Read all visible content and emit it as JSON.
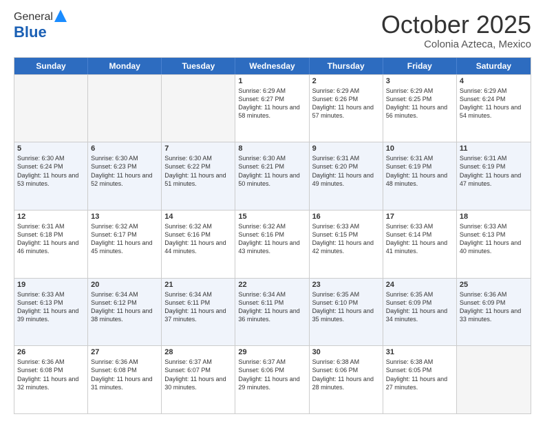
{
  "header": {
    "logo_general": "General",
    "logo_blue": "Blue",
    "month_title": "October 2025",
    "subtitle": "Colonia Azteca, Mexico"
  },
  "days_of_week": [
    "Sunday",
    "Monday",
    "Tuesday",
    "Wednesday",
    "Thursday",
    "Friday",
    "Saturday"
  ],
  "weeks": [
    [
      {
        "day": "",
        "sunrise": "",
        "sunset": "",
        "daylight": ""
      },
      {
        "day": "",
        "sunrise": "",
        "sunset": "",
        "daylight": ""
      },
      {
        "day": "",
        "sunrise": "",
        "sunset": "",
        "daylight": ""
      },
      {
        "day": "1",
        "sunrise": "Sunrise: 6:29 AM",
        "sunset": "Sunset: 6:27 PM",
        "daylight": "Daylight: 11 hours and 58 minutes."
      },
      {
        "day": "2",
        "sunrise": "Sunrise: 6:29 AM",
        "sunset": "Sunset: 6:26 PM",
        "daylight": "Daylight: 11 hours and 57 minutes."
      },
      {
        "day": "3",
        "sunrise": "Sunrise: 6:29 AM",
        "sunset": "Sunset: 6:25 PM",
        "daylight": "Daylight: 11 hours and 56 minutes."
      },
      {
        "day": "4",
        "sunrise": "Sunrise: 6:29 AM",
        "sunset": "Sunset: 6:24 PM",
        "daylight": "Daylight: 11 hours and 54 minutes."
      }
    ],
    [
      {
        "day": "5",
        "sunrise": "Sunrise: 6:30 AM",
        "sunset": "Sunset: 6:24 PM",
        "daylight": "Daylight: 11 hours and 53 minutes."
      },
      {
        "day": "6",
        "sunrise": "Sunrise: 6:30 AM",
        "sunset": "Sunset: 6:23 PM",
        "daylight": "Daylight: 11 hours and 52 minutes."
      },
      {
        "day": "7",
        "sunrise": "Sunrise: 6:30 AM",
        "sunset": "Sunset: 6:22 PM",
        "daylight": "Daylight: 11 hours and 51 minutes."
      },
      {
        "day": "8",
        "sunrise": "Sunrise: 6:30 AM",
        "sunset": "Sunset: 6:21 PM",
        "daylight": "Daylight: 11 hours and 50 minutes."
      },
      {
        "day": "9",
        "sunrise": "Sunrise: 6:31 AM",
        "sunset": "Sunset: 6:20 PM",
        "daylight": "Daylight: 11 hours and 49 minutes."
      },
      {
        "day": "10",
        "sunrise": "Sunrise: 6:31 AM",
        "sunset": "Sunset: 6:19 PM",
        "daylight": "Daylight: 11 hours and 48 minutes."
      },
      {
        "day": "11",
        "sunrise": "Sunrise: 6:31 AM",
        "sunset": "Sunset: 6:19 PM",
        "daylight": "Daylight: 11 hours and 47 minutes."
      }
    ],
    [
      {
        "day": "12",
        "sunrise": "Sunrise: 6:31 AM",
        "sunset": "Sunset: 6:18 PM",
        "daylight": "Daylight: 11 hours and 46 minutes."
      },
      {
        "day": "13",
        "sunrise": "Sunrise: 6:32 AM",
        "sunset": "Sunset: 6:17 PM",
        "daylight": "Daylight: 11 hours and 45 minutes."
      },
      {
        "day": "14",
        "sunrise": "Sunrise: 6:32 AM",
        "sunset": "Sunset: 6:16 PM",
        "daylight": "Daylight: 11 hours and 44 minutes."
      },
      {
        "day": "15",
        "sunrise": "Sunrise: 6:32 AM",
        "sunset": "Sunset: 6:16 PM",
        "daylight": "Daylight: 11 hours and 43 minutes."
      },
      {
        "day": "16",
        "sunrise": "Sunrise: 6:33 AM",
        "sunset": "Sunset: 6:15 PM",
        "daylight": "Daylight: 11 hours and 42 minutes."
      },
      {
        "day": "17",
        "sunrise": "Sunrise: 6:33 AM",
        "sunset": "Sunset: 6:14 PM",
        "daylight": "Daylight: 11 hours and 41 minutes."
      },
      {
        "day": "18",
        "sunrise": "Sunrise: 6:33 AM",
        "sunset": "Sunset: 6:13 PM",
        "daylight": "Daylight: 11 hours and 40 minutes."
      }
    ],
    [
      {
        "day": "19",
        "sunrise": "Sunrise: 6:33 AM",
        "sunset": "Sunset: 6:13 PM",
        "daylight": "Daylight: 11 hours and 39 minutes."
      },
      {
        "day": "20",
        "sunrise": "Sunrise: 6:34 AM",
        "sunset": "Sunset: 6:12 PM",
        "daylight": "Daylight: 11 hours and 38 minutes."
      },
      {
        "day": "21",
        "sunrise": "Sunrise: 6:34 AM",
        "sunset": "Sunset: 6:11 PM",
        "daylight": "Daylight: 11 hours and 37 minutes."
      },
      {
        "day": "22",
        "sunrise": "Sunrise: 6:34 AM",
        "sunset": "Sunset: 6:11 PM",
        "daylight": "Daylight: 11 hours and 36 minutes."
      },
      {
        "day": "23",
        "sunrise": "Sunrise: 6:35 AM",
        "sunset": "Sunset: 6:10 PM",
        "daylight": "Daylight: 11 hours and 35 minutes."
      },
      {
        "day": "24",
        "sunrise": "Sunrise: 6:35 AM",
        "sunset": "Sunset: 6:09 PM",
        "daylight": "Daylight: 11 hours and 34 minutes."
      },
      {
        "day": "25",
        "sunrise": "Sunrise: 6:36 AM",
        "sunset": "Sunset: 6:09 PM",
        "daylight": "Daylight: 11 hours and 33 minutes."
      }
    ],
    [
      {
        "day": "26",
        "sunrise": "Sunrise: 6:36 AM",
        "sunset": "Sunset: 6:08 PM",
        "daylight": "Daylight: 11 hours and 32 minutes."
      },
      {
        "day": "27",
        "sunrise": "Sunrise: 6:36 AM",
        "sunset": "Sunset: 6:08 PM",
        "daylight": "Daylight: 11 hours and 31 minutes."
      },
      {
        "day": "28",
        "sunrise": "Sunrise: 6:37 AM",
        "sunset": "Sunset: 6:07 PM",
        "daylight": "Daylight: 11 hours and 30 minutes."
      },
      {
        "day": "29",
        "sunrise": "Sunrise: 6:37 AM",
        "sunset": "Sunset: 6:06 PM",
        "daylight": "Daylight: 11 hours and 29 minutes."
      },
      {
        "day": "30",
        "sunrise": "Sunrise: 6:38 AM",
        "sunset": "Sunset: 6:06 PM",
        "daylight": "Daylight: 11 hours and 28 minutes."
      },
      {
        "day": "31",
        "sunrise": "Sunrise: 6:38 AM",
        "sunset": "Sunset: 6:05 PM",
        "daylight": "Daylight: 11 hours and 27 minutes."
      },
      {
        "day": "",
        "sunrise": "",
        "sunset": "",
        "daylight": ""
      }
    ]
  ]
}
